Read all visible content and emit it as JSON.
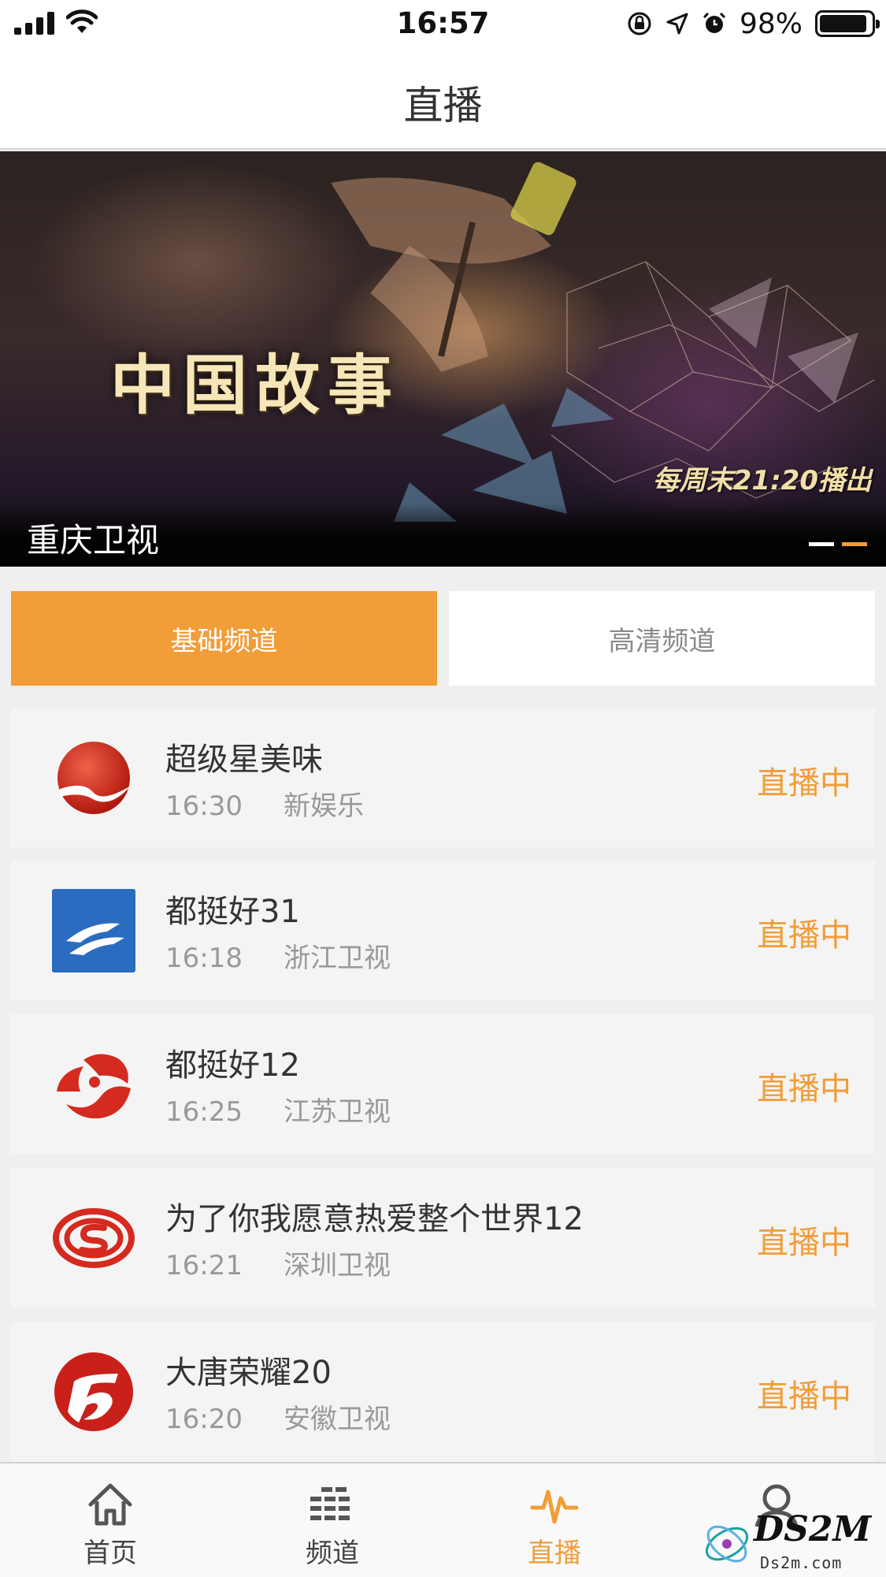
{
  "status_bar": {
    "time": "16:57",
    "battery_percent": "98%"
  },
  "header": {
    "title": "直播"
  },
  "banner": {
    "headline": "中国故事",
    "schedule": "每周末21:20播出",
    "channel_caption": "重庆卫视",
    "slides": 2,
    "active_slide": 2
  },
  "tabs": [
    {
      "label": "基础频道",
      "active": true
    },
    {
      "label": "高清频道",
      "active": false
    }
  ],
  "channels": [
    {
      "show": "超级星美味",
      "time": "16:30",
      "channel": "新娱乐",
      "status": "直播中",
      "logo_icon": "red-sphere-logo-icon"
    },
    {
      "show": "都挺好31",
      "time": "16:18",
      "channel": "浙江卫视",
      "status": "直播中",
      "logo_icon": "zhejiang-tv-logo-icon"
    },
    {
      "show": "都挺好12",
      "time": "16:25",
      "channel": "江苏卫视",
      "status": "直播中",
      "logo_icon": "jiangsu-tv-logo-icon"
    },
    {
      "show": "为了你我愿意热爱整个世界12",
      "time": "16:21",
      "channel": "深圳卫视",
      "status": "直播中",
      "logo_icon": "shenzhen-tv-logo-icon"
    },
    {
      "show": "大唐荣耀20",
      "time": "16:20",
      "channel": "安徽卫视",
      "status": "直播中",
      "logo_icon": "anhui-tv-logo-icon"
    }
  ],
  "tabbar": [
    {
      "label": "首页",
      "icon": "home-icon",
      "active": false
    },
    {
      "label": "频道",
      "icon": "channel-grid-icon",
      "active": false
    },
    {
      "label": "直播",
      "icon": "pulse-icon",
      "active": true
    },
    {
      "label": "",
      "icon": "user-icon",
      "active": false
    }
  ],
  "watermark": {
    "brand": "DS2M",
    "url": "Ds2m.com"
  },
  "colors": {
    "accent": "#f19d38",
    "text": "#333333",
    "muted": "#999999"
  }
}
